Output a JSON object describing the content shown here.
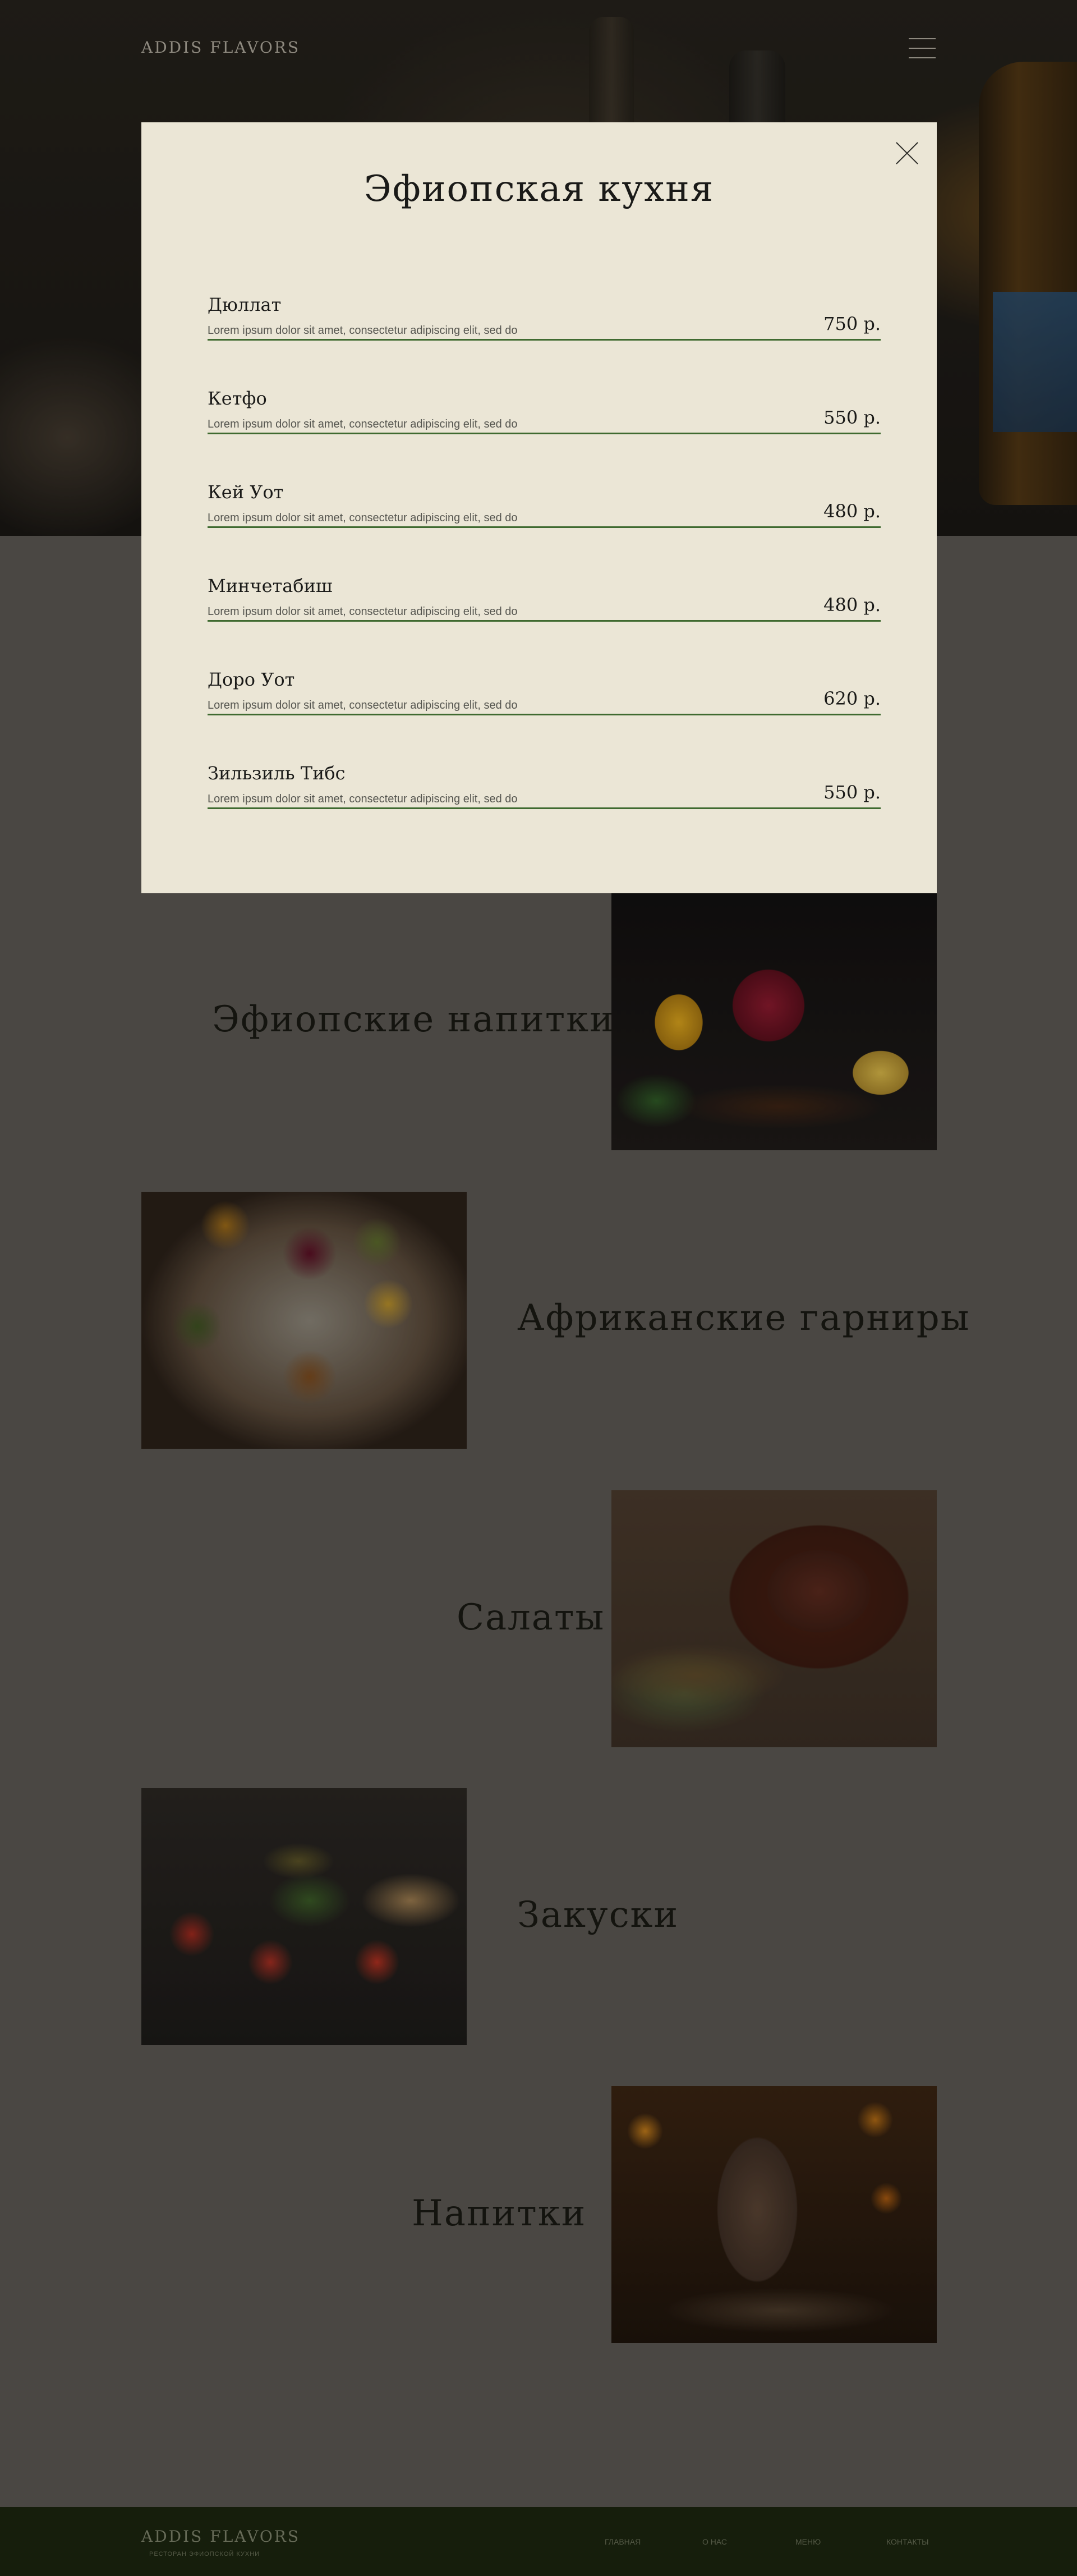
{
  "header": {
    "logo": "ADDIS FLAVORS"
  },
  "modal": {
    "title": "Эфиопская кухня",
    "items": [
      {
        "name": "Дюллат",
        "description": "Lorem ipsum dolor sit amet, consectetur adipiscing elit, sed do",
        "price": "750 р."
      },
      {
        "name": "Кетфо",
        "description": "Lorem ipsum dolor sit amet, consectetur adipiscing elit, sed do",
        "price": "550 р."
      },
      {
        "name": "Кей Уот",
        "description": "Lorem ipsum dolor sit amet, consectetur adipiscing elit, sed do",
        "price": "480 р."
      },
      {
        "name": "Минчетабиш",
        "description": "Lorem ipsum dolor sit amet, consectetur adipiscing elit, sed do",
        "price": "480 р."
      },
      {
        "name": "Доро Уот",
        "description": "Lorem ipsum dolor sit amet, consectetur adipiscing elit, sed do",
        "price": "620 р."
      },
      {
        "name": "Зильзиль Тибс",
        "description": "Lorem ipsum dolor sit amet, consectetur adipiscing elit, sed do",
        "price": "550 р."
      }
    ]
  },
  "categories": [
    {
      "title": "Эфиопские напитки"
    },
    {
      "title": "Африканские гарниры"
    },
    {
      "title": "Салаты"
    },
    {
      "title": "Закуски"
    },
    {
      "title": "Напитки"
    }
  ],
  "footer": {
    "logo": "ADDIS FLAVORS",
    "tagline": "РЕСТОРАН ЭФИОПСКОЙ КУХНИ",
    "nav": [
      "ГЛАВНАЯ",
      "О НАС",
      "МЕНЮ",
      "КОНТАКТЫ"
    ]
  },
  "colors": {
    "modal_bg": "#ebe6d6",
    "accent_rule": "#3f6a30",
    "page_bg": "#4a4743",
    "footer_bg": "#161e0c"
  }
}
